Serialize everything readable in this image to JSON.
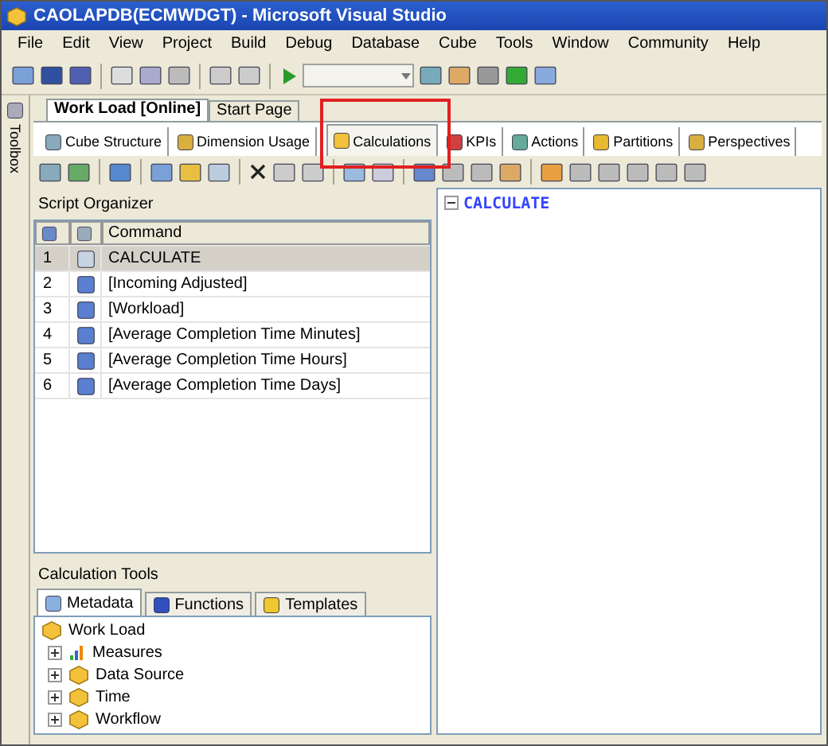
{
  "window": {
    "title": "CAOLAPDB(ECMWDGT) - Microsoft Visual Studio"
  },
  "menu": [
    "File",
    "Edit",
    "View",
    "Project",
    "Build",
    "Debug",
    "Database",
    "Cube",
    "Tools",
    "Window",
    "Community",
    "Help"
  ],
  "toolbox": {
    "label": "Toolbox"
  },
  "doc_tabs": [
    {
      "label": "Work Load [Online]",
      "selected": true
    },
    {
      "label": "Start Page",
      "selected": false
    }
  ],
  "designer_tabs": [
    {
      "label": "Cube Structure",
      "selected": false
    },
    {
      "label": "Dimension Usage",
      "selected": false
    },
    {
      "label": "Calculations",
      "selected": true,
      "highlighted": true
    },
    {
      "label": "KPIs",
      "selected": false
    },
    {
      "label": "Actions",
      "selected": false
    },
    {
      "label": "Partitions",
      "selected": false
    },
    {
      "label": "Perspectives",
      "selected": false
    }
  ],
  "script_organizer": {
    "title": "Script Organizer",
    "columns": [
      "Command"
    ],
    "rows": [
      {
        "number": "1",
        "command": "CALCULATE",
        "kind": "script",
        "selected": true
      },
      {
        "number": "2",
        "command": "[Incoming Adjusted]",
        "kind": "calc",
        "selected": false
      },
      {
        "number": "3",
        "command": "[Workload]",
        "kind": "calc",
        "selected": false
      },
      {
        "number": "4",
        "command": "[Average Completion Time Minutes]",
        "kind": "calc",
        "selected": false
      },
      {
        "number": "5",
        "command": "[Average Completion Time Hours]",
        "kind": "calc",
        "selected": false
      },
      {
        "number": "6",
        "command": "[Average Completion Time Days]",
        "kind": "calc",
        "selected": false
      }
    ]
  },
  "editor": {
    "code": "CALCULATE"
  },
  "calculation_tools": {
    "title": "Calculation Tools",
    "tabs": [
      {
        "label": "Metadata",
        "selected": true
      },
      {
        "label": "Functions",
        "selected": false
      },
      {
        "label": "Templates",
        "selected": false
      }
    ],
    "tree": {
      "label": "Work Load",
      "children": [
        {
          "label": "Measures",
          "kind": "measures",
          "expanded": false
        },
        {
          "label": "Data Source",
          "kind": "dimension",
          "expanded": false
        },
        {
          "label": "Time",
          "kind": "dimension",
          "expanded": false
        },
        {
          "label": "Workflow",
          "kind": "dimension",
          "expanded": false
        }
      ]
    }
  }
}
